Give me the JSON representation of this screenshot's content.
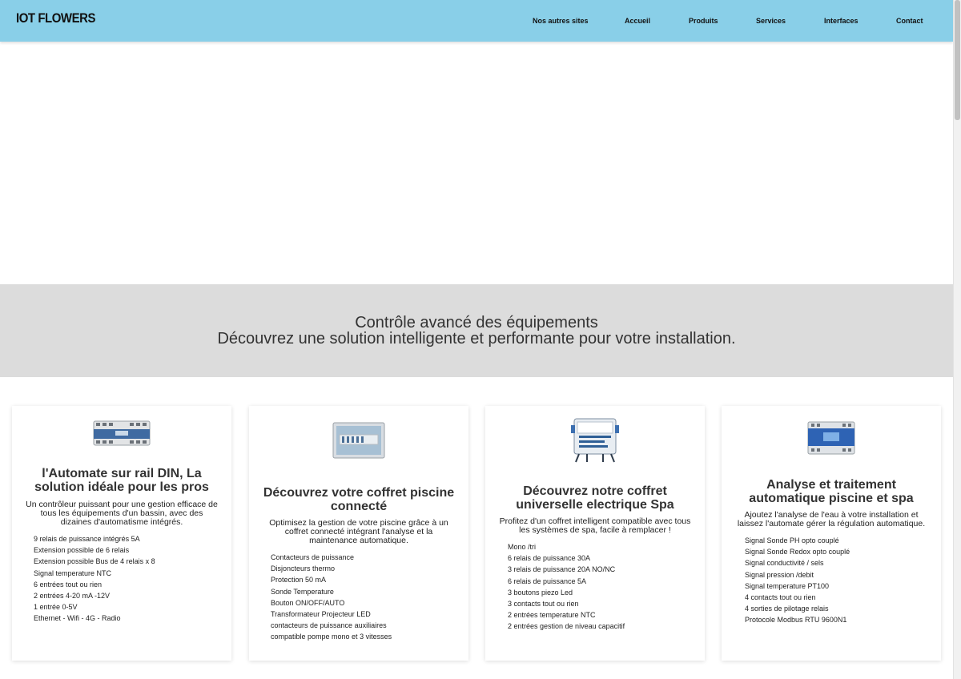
{
  "header": {
    "logo": "IOT FLOWERS",
    "nav": [
      "Nos autres sites",
      "Accueil",
      "Produits",
      "Services",
      "Interfaces",
      "Contact"
    ]
  },
  "banner": {
    "line1": "Contrôle avancé des équipements",
    "line2": "Découvrez une solution intelligente et performante pour votre installation."
  },
  "cards": [
    {
      "image": "din-rail-controller",
      "title": "l'Automate sur rail DIN, La solution idéale pour les pros",
      "description": "Un contrôleur puissant pour une gestion efficace de tous les équipements d'un bassin, avec des dizaines d'automatisme intégrés.",
      "features": [
        "9 relais de puissance intégrés 5A",
        "Extension possible de 6 relais",
        "Extension possible Bus de 4 relais x 8",
        "Signal temperature NTC",
        "6 entrées tout ou rien",
        "2 entrées 4-20 mA -12V",
        "1 entrée 0-5V",
        "Ethernet - Wifi - 4G - Radio"
      ]
    },
    {
      "image": "pool-electrical-box",
      "title": "Découvrez votre coffret piscine connecté",
      "description": "Optimisez la gestion de votre piscine grâce à un coffret connecté intégrant l'analyse et la maintenance automatique.",
      "features": [
        "Contacteurs de puissance",
        "Disjoncteurs thermo",
        "Protection 50 mA",
        "Sonde Temperature",
        "Bouton ON/OFF/AUTO",
        "Transformateur Projecteur LED",
        "contacteurs de puissance auxiliaires",
        "compatible pompe mono et 3 vitesses"
      ]
    },
    {
      "image": "spa-control-board",
      "title": "Découvrez notre coffret universelle electrique Spa",
      "description": "Profitez d'un coffret intelligent compatible avec tous les systèmes de spa, facile à remplacer !",
      "features": [
        "Mono /tri",
        "6 relais de puissance 30A",
        "3 relais de puissance 20A NO/NC",
        "6 relais de puissance 5A",
        "3 boutons piezo Led",
        "3 contacts tout ou rien",
        "2 entrées temperature NTC",
        "2 entrées gestion de niveau capacitif"
      ]
    },
    {
      "image": "water-analysis-module",
      "title": "Analyse et traitement automatique piscine et spa",
      "description": "Ajoutez l'analyse de l'eau à votre installation et laissez l'automate gérer la régulation automatique.",
      "features": [
        "Signal Sonde PH opto couplé",
        "Signal Sonde Redox opto couplé",
        "Signal conductivité / sels",
        "Signal pression /debit",
        "Signal temperature PT100",
        "4 contacts tout ou rien",
        "4 sorties de pilotage relais",
        "Protocole Modbus RTU 9600N1"
      ]
    }
  ],
  "colors": {
    "header_bg": "#89cfe8",
    "banner_bg": "#dcdcdc",
    "card_bg": "#ffffff"
  }
}
